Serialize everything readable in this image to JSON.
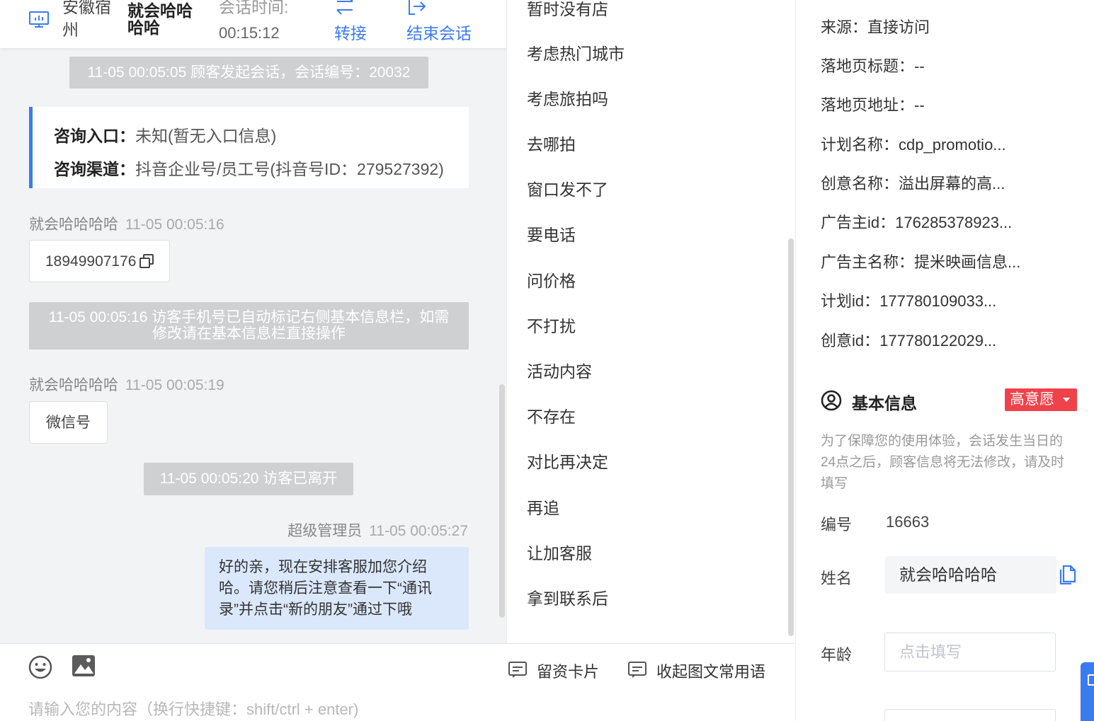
{
  "chat_header": {
    "location": "安徽宿州",
    "visitor_name": "就会哈哈哈哈",
    "session_time_label": "会话时间:",
    "session_time_value": "00:15:12",
    "transfer_label": "转接",
    "end_session_label": "结束会话"
  },
  "messages": {
    "system_start": "11-05 00:05:05 顾客发起会话，会话编号：20032",
    "entry": {
      "label1": "咨询入口：",
      "value1": "未知(暂无入口信息)",
      "label2": "咨询渠道：",
      "value2": "抖音企业号/员工号(抖音号ID：279527392)"
    },
    "msg1_sender": "就会哈哈哈哈",
    "msg1_time": "11-05 00:05:16",
    "msg1_text": "18949907176",
    "system_phone": "11-05 00:05:16 访客手机号已自动标记右侧基本信息栏，如需修改请在基本信息栏直接操作",
    "msg2_sender": "就会哈哈哈哈",
    "msg2_time": "11-05 00:05:19",
    "msg2_text": "微信号",
    "system_left": "11-05 00:05:20 访客已离开",
    "msg3_sender": "超级管理员",
    "msg3_time": "11-05 00:05:27",
    "msg3_text": "好的亲，现在安排客服加您介绍哈。请您稍后注意查看一下“通讯录”并点击“新的朋友”通过下哦"
  },
  "composer": {
    "card_label": "留资卡片",
    "collapse_label": "收起图文常用语",
    "placeholder": "请输入您的内容（换行快捷键：shift/ctrl + enter)"
  },
  "phrases": [
    "暂时没有店",
    "考虑热门城市",
    "考虑旅拍吗",
    "去哪拍",
    "窗口发不了",
    "要电话",
    "问价格",
    "不打扰",
    "活动内容",
    "不存在",
    "对比再决定",
    "再追",
    "让加客服",
    "拿到联系后"
  ],
  "visitor_info": {
    "source": "来源：直接访问",
    "landing_title": "落地页标题：--",
    "landing_url": "落地页地址：--",
    "plan_name": "计划名称：cdp_promotio...",
    "creative_name": "创意名称：溢出屏幕的高...",
    "advertiser_id": "广告主id：176285378923...",
    "advertiser_name": "广告主名称：提米映画信息...",
    "plan_id": "计划id：177780109033...",
    "creative_id": "创意id：177780122029..."
  },
  "basic_info": {
    "title": "基本信息",
    "intent_badge": "高意愿",
    "notice": "为了保障您的使用体验，会话发生当日的24点之后，顾客信息将无法修改，请及时填写",
    "id_label": "编号",
    "id_value": "16663",
    "name_label": "姓名",
    "name_value": "就会哈哈哈哈",
    "age_label": "年龄",
    "age_placeholder": "点击填写"
  },
  "colors": {
    "accent": "#3a7bf0",
    "intent_red": "#f0424b",
    "outgoing_bubble": "#dbe8fc",
    "system_msg": "#cfd0d2"
  },
  "icons": [
    "monitor-icon",
    "transfer-icon",
    "exit-icon",
    "copy-icon",
    "emoji-icon",
    "image-icon",
    "card-icon",
    "message-icon",
    "user-circle-icon",
    "caret-down-icon"
  ]
}
